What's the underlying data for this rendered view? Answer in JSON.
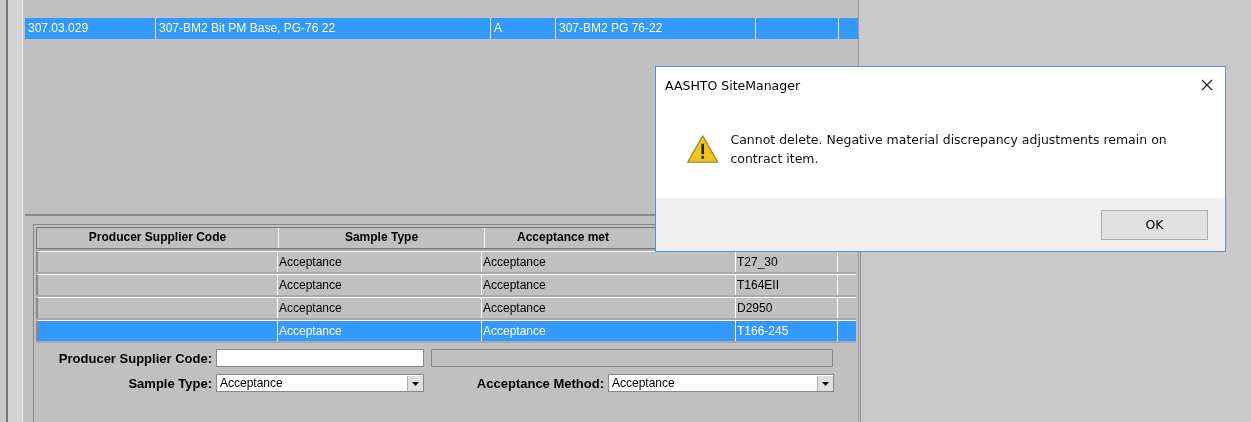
{
  "materials_table": {
    "rows": [
      {
        "cells": [
          "307.03.029",
          "307-BM2 Bit PM Base, PG-76 22",
          "A",
          "307-BM2 PG 76-22",
          null
        ],
        "selected": true
      }
    ]
  },
  "samples_grid": {
    "columns": [
      "Producer Supplier Code",
      "Sample Type",
      "Acceptance met"
    ],
    "rows": [
      {
        "cells": [
          null,
          "Acceptance",
          "Acceptance",
          "T27_30"
        ],
        "selected": false
      },
      {
        "cells": [
          null,
          "Acceptance",
          "Acceptance",
          "T164EII"
        ],
        "selected": false
      },
      {
        "cells": [
          null,
          "Acceptance",
          "Acceptance",
          "D2950"
        ],
        "selected": false
      },
      {
        "cells": [
          null,
          "Acceptance",
          "Acceptance",
          "T166-245"
        ],
        "selected": true
      }
    ]
  },
  "form": {
    "producer_supplier_code": {
      "label": "Producer Supplier Code:"
    },
    "sample_type": {
      "label": "Sample Type:",
      "value": "Acceptance"
    },
    "acceptance_method": {
      "label": "Acceptance Method:",
      "value": "Acceptance"
    }
  },
  "dialog": {
    "title": "AASHTO SiteManager",
    "message": "Cannot delete.  Negative material discrepancy adjustments remain on contract item.",
    "buttons": [
      "OK"
    ]
  }
}
